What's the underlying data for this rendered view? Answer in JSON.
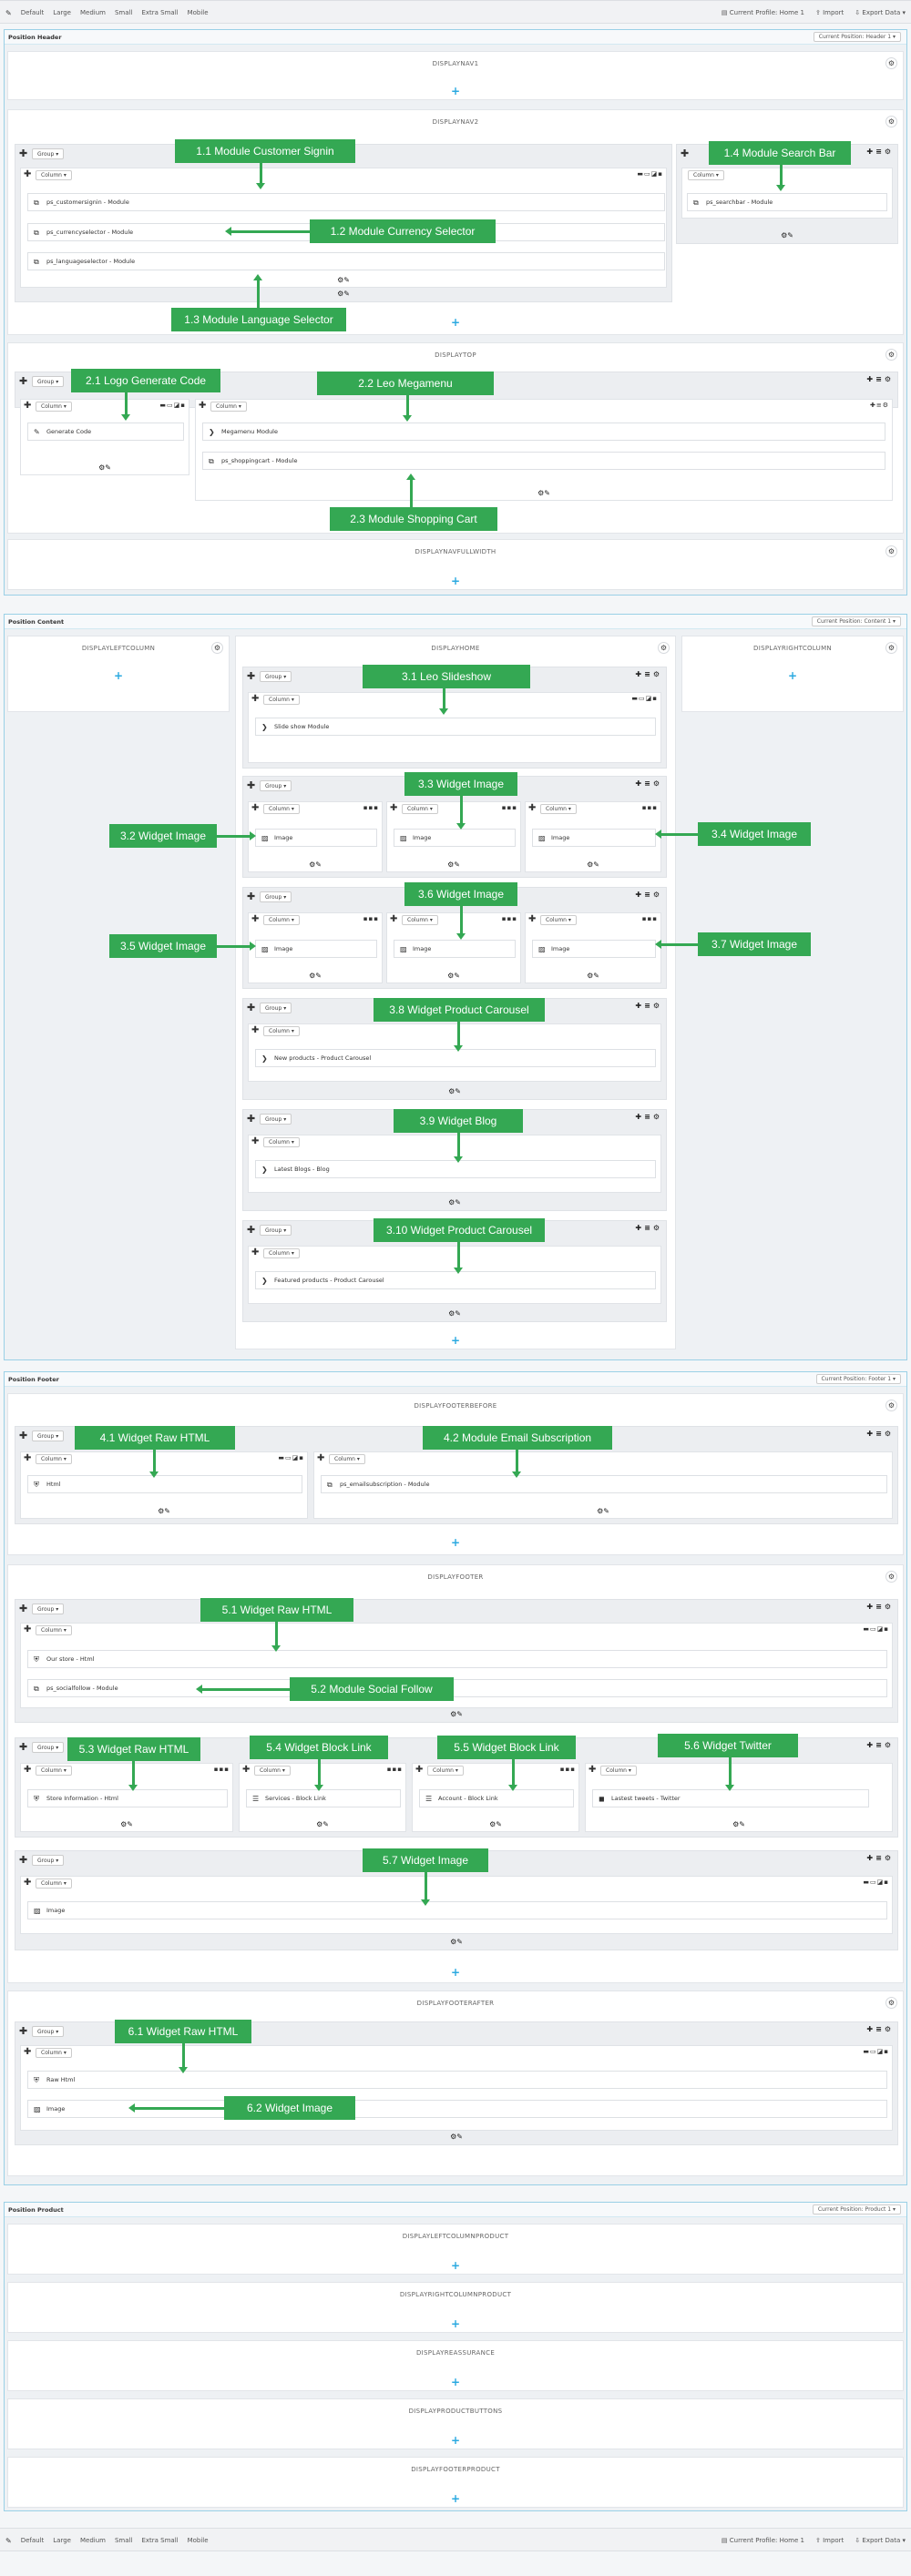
{
  "toolbar": {
    "devices": [
      "Default",
      "Large",
      "Medium",
      "Small",
      "Extra Small",
      "Mobile"
    ],
    "current_profile": "Current Profile: Home 1",
    "import": "Import",
    "export": "Export Data"
  },
  "header": {
    "title": "Position Header",
    "profile": "Current Position: Header 1",
    "hooks": [
      "DISPLAYNAV1",
      "DISPLAYNAV2",
      "DISPLAYTOP",
      "DISPLAYNAVFULLWIDTH"
    ]
  },
  "content": {
    "title": "Position Content",
    "profile": "Current Position: Content 1",
    "hooks": [
      "DISPLAYLEFTCOLUMN",
      "DISPLAYHOME",
      "DISPLAYRIGHTCOLUMN"
    ]
  },
  "footer": {
    "title": "Position Footer",
    "profile": "Current Position: Footer 1",
    "hooks": [
      "DISPLAYFOOTERBEFORE",
      "DISPLAYFOOTER",
      "DISPLAYFOOTERAFTER"
    ]
  },
  "product": {
    "title": "Position Product",
    "profile": "Current Position: Product 1",
    "hooks": [
      "DISPLAYLEFTCOLUMNPRODUCT",
      "DISPLAYRIGHTCOLUMNPRODUCT",
      "DISPLAYREASSURANCE",
      "DISPLAYPRODUCTBUTTONS",
      "DISPLAYFOOTERPRODUCT"
    ]
  },
  "ui": {
    "group": "Group",
    "column": "Column"
  },
  "modules": {
    "signin": "ps_customersignin - Module",
    "currency": "ps_currencyselector - Module",
    "language": "ps_languageselector - Module",
    "search": "ps_searchbar - Module",
    "gencode": "Generate Code",
    "megamenu": "Megamenu Module",
    "cart": "ps_shoppingcart - Module",
    "slideshow": "Slide show Module",
    "image": "Image",
    "newprod": "New products - Product Carousel",
    "blog": "Latest Blogs - Blog",
    "featured": "Featured products - Product Carousel",
    "html": "Html",
    "email": "ps_emailsubscription - Module",
    "ourstore": "Our store - Html",
    "social": "ps_socialfollow - Module",
    "storeinfo": "Store Information - Html",
    "services": "Services - Block Link",
    "account": "Account - Block Link",
    "tweets": "Lastest tweets - Twitter",
    "rawhtml": "Raw Html"
  },
  "labels": {
    "l11": "1.1 Module Customer Signin",
    "l12": "1.2 Module Currency Selector",
    "l13": "1.3 Module Language Selector",
    "l14": "1.4 Module Search Bar",
    "l21": "2.1 Logo Generate Code",
    "l22": "2.2 Leo Megamenu",
    "l23": "2.3 Module Shopping Cart",
    "l31": "3.1 Leo Slideshow",
    "l32": "3.2 Widget Image",
    "l33": "3.3 Widget Image",
    "l34": "3.4 Widget Image",
    "l35": "3.5 Widget Image",
    "l36": "3.6 Widget Image",
    "l37": "3.7 Widget Image",
    "l38": "3.8 Widget Product Carousel",
    "l39": "3.9 Widget Blog",
    "l310": "3.10 Widget Product Carousel",
    "l41": "4.1 Widget Raw HTML",
    "l42": "4.2 Module Email Subscription",
    "l51": "5.1 Widget Raw HTML",
    "l52": "5.2 Module Social Follow",
    "l53": "5.3 Widget Raw HTML",
    "l54": "5.4 Widget Block Link",
    "l55": "5.5 Widget Block Link",
    "l56": "5.6 Widget Twitter",
    "l57": "5.7 Widget Image",
    "l61": "6.1 Widget Raw HTML",
    "l62": "6.2 Widget Image"
  }
}
